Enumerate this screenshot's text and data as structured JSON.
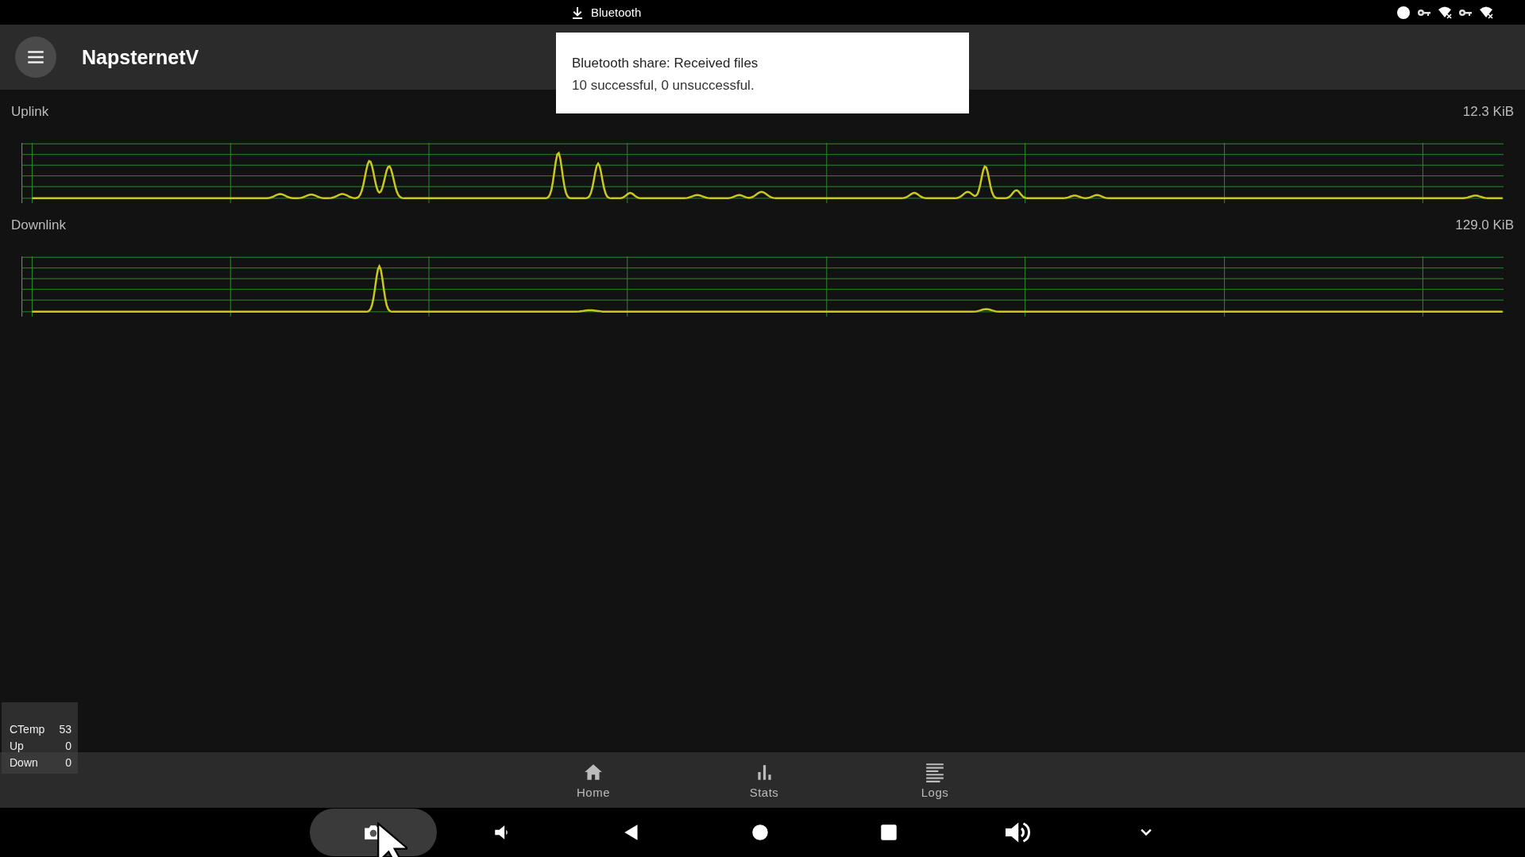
{
  "status_bar": {
    "notification": "Bluetooth"
  },
  "app_bar": {
    "title": "NapsternetV"
  },
  "toast": {
    "title": "Bluetooth share: Received files",
    "message": "10 successful, 0 unsuccessful."
  },
  "graphs": [
    {
      "label": "Uplink",
      "value": "12.3 KiB"
    },
    {
      "label": "Downlink",
      "value": "129.0 KiB"
    }
  ],
  "stats_overlay": [
    {
      "label": "CTemp",
      "value": "53"
    },
    {
      "label": "Up",
      "value": "0"
    },
    {
      "label": "Down",
      "value": "0"
    }
  ],
  "bottom_nav": [
    {
      "label": "Home"
    },
    {
      "label": "Stats"
    },
    {
      "label": "Logs"
    }
  ]
}
